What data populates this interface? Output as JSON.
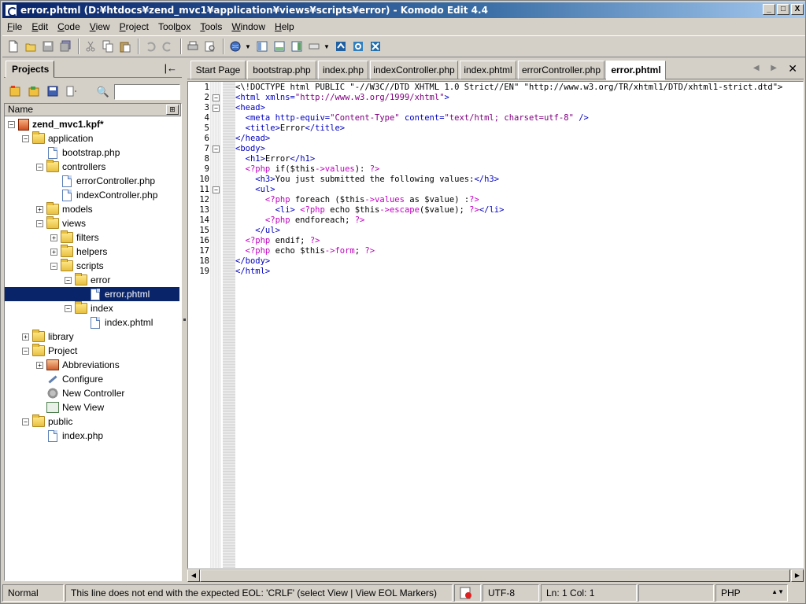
{
  "window": {
    "title": "error.phtml (D:¥htdocs¥zend_mvc1¥application¥views¥scripts¥error) - Komodo Edit 4.4",
    "controls": {
      "minimize": "_",
      "maximize": "□",
      "close": "X"
    }
  },
  "menu": [
    {
      "label": "File",
      "accel": "F"
    },
    {
      "label": "Edit",
      "accel": "E"
    },
    {
      "label": "Code",
      "accel": "C"
    },
    {
      "label": "View",
      "accel": "V"
    },
    {
      "label": "Project",
      "accel": "P"
    },
    {
      "label": "Toolbox",
      "accel": "b"
    },
    {
      "label": "Tools",
      "accel": "T"
    },
    {
      "label": "Window",
      "accel": "W"
    },
    {
      "label": "Help",
      "accel": "H"
    }
  ],
  "projects_panel": {
    "tab_label": "Projects",
    "collapse_glyph": "|←",
    "search_value": "",
    "column_header": "Name",
    "tree": [
      {
        "label": "zend_mvc1.kpf*",
        "depth": 0,
        "type": "kpf",
        "expander": "−",
        "bold": true
      },
      {
        "label": "application",
        "depth": 1,
        "type": "folder",
        "expander": "−"
      },
      {
        "label": "bootstrap.php",
        "depth": 2,
        "type": "file",
        "expander": ""
      },
      {
        "label": "controllers",
        "depth": 2,
        "type": "folder",
        "expander": "−"
      },
      {
        "label": "errorController.php",
        "depth": 3,
        "type": "file",
        "expander": ""
      },
      {
        "label": "indexController.php",
        "depth": 3,
        "type": "file",
        "expander": ""
      },
      {
        "label": "models",
        "depth": 2,
        "type": "folder",
        "expander": "+"
      },
      {
        "label": "views",
        "depth": 2,
        "type": "folder",
        "expander": "−"
      },
      {
        "label": "filters",
        "depth": 3,
        "type": "folder",
        "expander": "+"
      },
      {
        "label": "helpers",
        "depth": 3,
        "type": "folder",
        "expander": "+"
      },
      {
        "label": "scripts",
        "depth": 3,
        "type": "folder",
        "expander": "−"
      },
      {
        "label": "error",
        "depth": 4,
        "type": "folder",
        "expander": "−"
      },
      {
        "label": "error.phtml",
        "depth": 5,
        "type": "file",
        "expander": "",
        "selected": true
      },
      {
        "label": "index",
        "depth": 4,
        "type": "folder",
        "expander": "−"
      },
      {
        "label": "index.phtml",
        "depth": 5,
        "type": "file",
        "expander": ""
      },
      {
        "label": "library",
        "depth": 1,
        "type": "folder",
        "expander": "+"
      },
      {
        "label": "Project",
        "depth": 1,
        "type": "folder",
        "expander": "−"
      },
      {
        "label": "Abbreviations",
        "depth": 2,
        "type": "abbr",
        "expander": "+"
      },
      {
        "label": "Configure",
        "depth": 2,
        "type": "tool",
        "expander": ""
      },
      {
        "label": "New Controller",
        "depth": 2,
        "type": "gear",
        "expander": ""
      },
      {
        "label": "New View",
        "depth": 2,
        "type": "view",
        "expander": ""
      },
      {
        "label": "public",
        "depth": 1,
        "type": "folder",
        "expander": "−"
      },
      {
        "label": "index.php",
        "depth": 2,
        "type": "file",
        "expander": ""
      }
    ]
  },
  "editor": {
    "tabs": [
      {
        "label": "Start Page",
        "active": false
      },
      {
        "label": "bootstrap.php",
        "active": false
      },
      {
        "label": "index.php",
        "active": false
      },
      {
        "label": "indexController.php",
        "active": false
      },
      {
        "label": "index.phtml",
        "active": false
      },
      {
        "label": "errorController.php",
        "active": false
      },
      {
        "label": "error.phtml",
        "active": true
      }
    ],
    "tab_nav": "◀ ▶",
    "close_glyph": "✕",
    "fold_markers": {
      "2": "−",
      "3": "−",
      "7": "−",
      "11": "−"
    },
    "lines": [
      [
        [
          "c-txt",
          "<\\!DOCTYPE html PUBLIC \"-//W3C//DTD XHTML 1.0 Strict//EN\" \"http://www.w3.org/TR/xhtml1/DTD/xhtml1-strict.dtd\">"
        ]
      ],
      [
        [
          "c-tag",
          "<html "
        ],
        [
          "c-attr",
          "xmlns="
        ],
        [
          "c-str",
          "\"http://www.w3.org/1999/xhtml\""
        ],
        [
          "c-tag",
          ">"
        ]
      ],
      [
        [
          "c-tag",
          "<head>"
        ]
      ],
      [
        [
          "c-tag",
          "  <meta "
        ],
        [
          "c-attr",
          "http-equiv="
        ],
        [
          "c-str",
          "\"Content-Type\" "
        ],
        [
          "c-attr",
          "content="
        ],
        [
          "c-str",
          "\"text/html; charset=utf-8\" "
        ],
        [
          "c-tag",
          "/>"
        ]
      ],
      [
        [
          "c-tag",
          "  <title>"
        ],
        [
          "c-txt",
          "Error"
        ],
        [
          "c-tag",
          "</title>"
        ]
      ],
      [
        [
          "c-tag",
          "</head>"
        ]
      ],
      [
        [
          "c-tag",
          "<body>"
        ]
      ],
      [
        [
          "c-tag",
          "  <h1>"
        ],
        [
          "c-txt",
          "Error"
        ],
        [
          "c-tag",
          "</h1>"
        ]
      ],
      [
        [
          "c-php",
          "  <?php "
        ],
        [
          "c-txt",
          "if("
        ],
        [
          "c-var",
          "$this"
        ],
        [
          "c-php",
          "->values"
        ],
        [
          "c-txt",
          "): "
        ],
        [
          "c-php",
          "?>"
        ]
      ],
      [
        [
          "c-tag",
          "    <h3>"
        ],
        [
          "c-txt",
          "You just submitted the following values:"
        ],
        [
          "c-tag",
          "</h3>"
        ]
      ],
      [
        [
          "c-tag",
          "    <ul>"
        ]
      ],
      [
        [
          "c-php",
          "      <?php "
        ],
        [
          "c-txt",
          "foreach ("
        ],
        [
          "c-var",
          "$this"
        ],
        [
          "c-php",
          "->values "
        ],
        [
          "c-txt",
          "as "
        ],
        [
          "c-var",
          "$value"
        ],
        [
          "c-txt",
          ") :"
        ],
        [
          "c-php",
          "?>"
        ]
      ],
      [
        [
          "c-tag",
          "        <li> "
        ],
        [
          "c-php",
          "<?php "
        ],
        [
          "c-txt",
          "echo "
        ],
        [
          "c-var",
          "$this"
        ],
        [
          "c-php",
          "->escape"
        ],
        [
          "c-txt",
          "("
        ],
        [
          "c-var",
          "$value"
        ],
        [
          "c-txt",
          "); "
        ],
        [
          "c-php",
          "?>"
        ],
        [
          "c-tag",
          "</li>"
        ]
      ],
      [
        [
          "c-php",
          "      <?php "
        ],
        [
          "c-txt",
          "endforeach; "
        ],
        [
          "c-php",
          "?>"
        ]
      ],
      [
        [
          "c-tag",
          "    </ul>"
        ]
      ],
      [
        [
          "c-php",
          "  <?php "
        ],
        [
          "c-txt",
          "endif; "
        ],
        [
          "c-php",
          "?>"
        ]
      ],
      [
        [
          "c-php",
          "  <?php "
        ],
        [
          "c-txt",
          "echo "
        ],
        [
          "c-var",
          "$this"
        ],
        [
          "c-php",
          "->form"
        ],
        [
          "c-txt",
          "; "
        ],
        [
          "c-php",
          "?>"
        ]
      ],
      [
        [
          "c-tag",
          "</body>"
        ]
      ],
      [
        [
          "c-tag",
          "</html>"
        ]
      ]
    ]
  },
  "statusbar": {
    "mode": "Normal",
    "message": "This line does not end with the expected EOL: 'CRLF' (select View | View EOL Markers)",
    "encoding": "UTF-8",
    "position": "Ln: 1 Col: 1",
    "language": "PHP",
    "dropdown_glyph": "▲▼"
  }
}
